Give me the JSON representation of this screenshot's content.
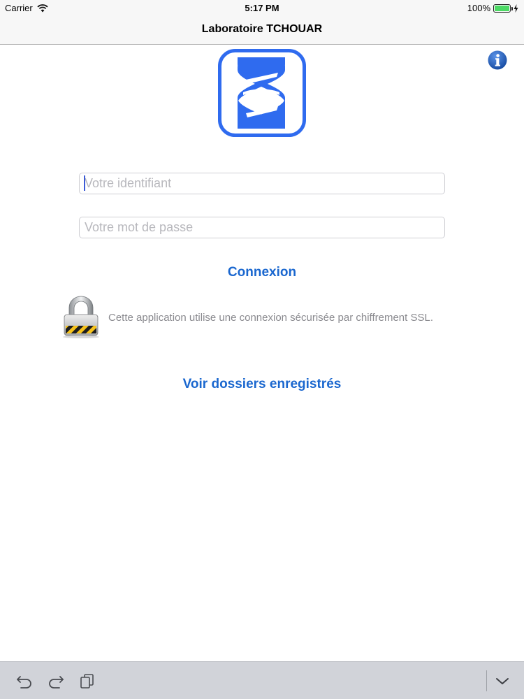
{
  "status_bar": {
    "carrier": "Carrier",
    "time": "5:17 PM",
    "battery": "100%",
    "battery_level": 1.0
  },
  "nav": {
    "title": "Laboratoire TCHOUAR"
  },
  "login": {
    "username_placeholder": "Votre identifiant",
    "username_value": "",
    "password_placeholder": "Votre mot de passe",
    "password_value": "",
    "connect_label": "Connexion"
  },
  "security": {
    "message": "Cette application utilise une connexion sécurisée par chiffrement SSL."
  },
  "saved": {
    "label": "Voir dossiers enregistrés"
  },
  "colors": {
    "accent": "#1a67cf",
    "logo_blue": "#2f6bef",
    "info_blue": "#1f5fc4",
    "battery_green": "#4cd964"
  },
  "icons": {
    "wifi": "wifi-icon",
    "info": "info-icon",
    "logo": "dna-helix-logo",
    "lock": "padlock-icon",
    "undo": "undo-icon",
    "redo": "redo-icon",
    "clipboard": "paste-icon",
    "dismiss": "chevron-down-icon"
  }
}
